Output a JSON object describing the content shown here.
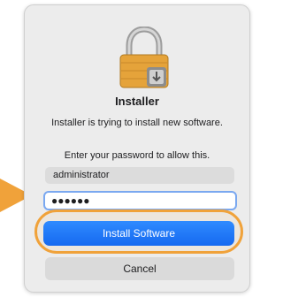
{
  "dialog": {
    "title": "Installer",
    "subtitle": "Installer is trying to install new software.",
    "prompt": "Enter your password to allow this.",
    "username_value": "administrator",
    "password_value": "●●●●●●",
    "install_label": "Install Software",
    "cancel_label": "Cancel"
  },
  "icons": {
    "lock": "lock-installer-icon",
    "arrow": "orange-arrow-icon"
  },
  "colors": {
    "accent_blue": "#1f7af8",
    "highlight_orange": "#f0a23a",
    "lock_gold": "#e8a93a"
  }
}
